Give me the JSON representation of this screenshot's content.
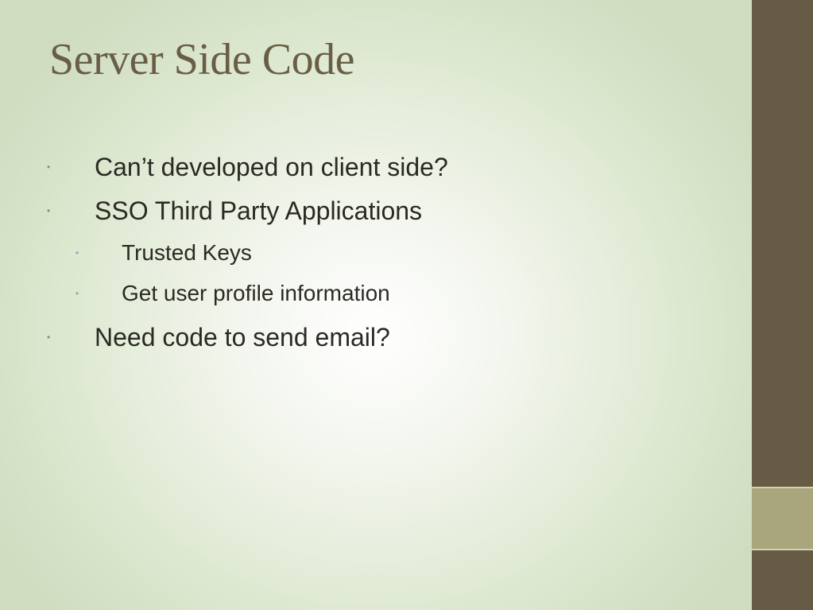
{
  "slide": {
    "title": "Server Side Code",
    "bullets": [
      {
        "text": "Can’t developed on client side?",
        "level": 1
      },
      {
        "text": "SSO Third Party Applications",
        "level": 1
      },
      {
        "text": "Trusted Keys",
        "level": 2
      },
      {
        "text": "Get user profile information",
        "level": 2
      },
      {
        "text": "Need code to send email?",
        "level": 1
      }
    ],
    "bullet_glyph": "•"
  },
  "colors": {
    "title": "#685e45",
    "body_text": "#2a2a23",
    "side_bar": "#665c45",
    "side_accent": "#a9a57d",
    "bullet_level1": "#8d8e74",
    "bullet_level2": "#8aaabb"
  }
}
